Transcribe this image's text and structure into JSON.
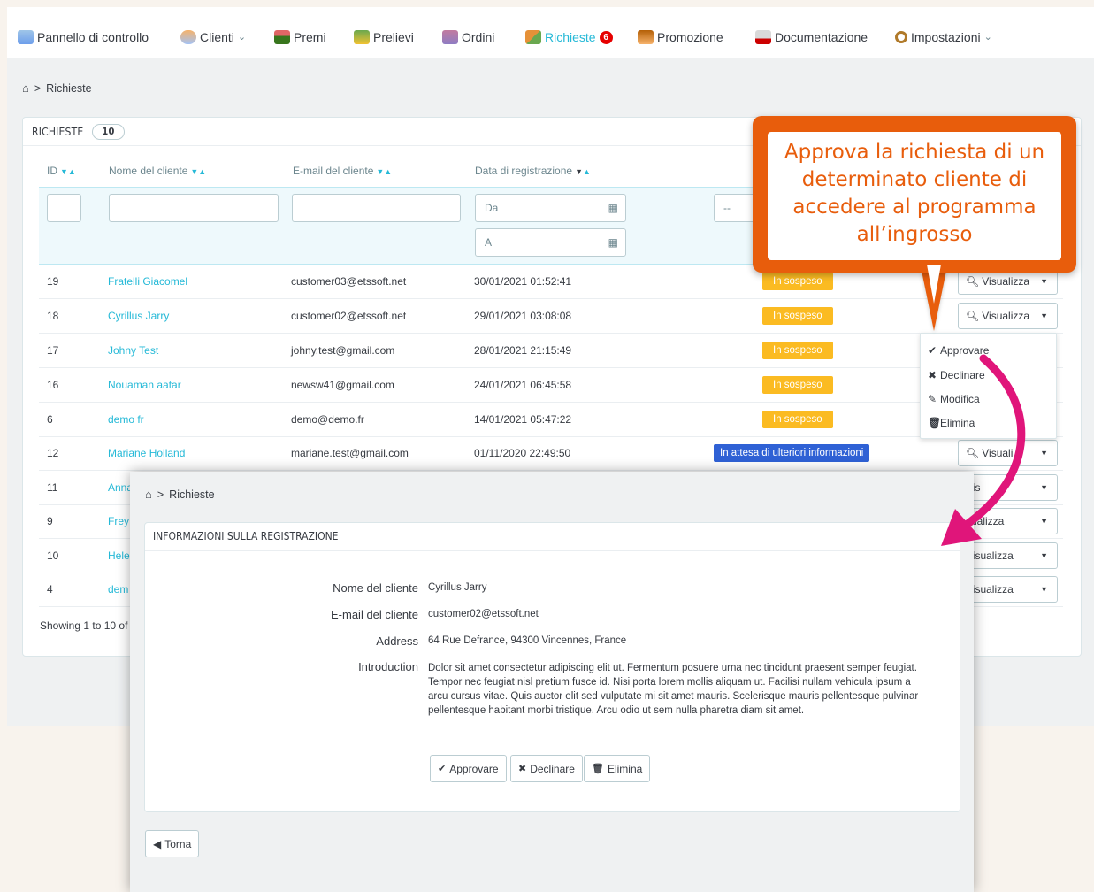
{
  "nav": {
    "items": [
      {
        "label": "Pannello di controllo",
        "icon": "dashboard-icon"
      },
      {
        "label": "Clienti",
        "icon": "customers-icon",
        "has_dropdown": true
      },
      {
        "label": "Premi",
        "icon": "rewards-icon"
      },
      {
        "label": "Prelievi",
        "icon": "withdrawals-icon"
      },
      {
        "label": "Ordini",
        "icon": "orders-icon"
      },
      {
        "label": "Richieste",
        "icon": "requests-icon",
        "badge": "6",
        "active": true
      },
      {
        "label": "Promozione",
        "icon": "promotion-icon"
      },
      {
        "label": "Documentazione",
        "icon": "documentation-icon"
      },
      {
        "label": "Impostazioni",
        "icon": "settings-icon",
        "has_dropdown": true
      }
    ]
  },
  "breadcrumb": {
    "current": "Richieste"
  },
  "list": {
    "title": "RICHIESTE",
    "count": "10",
    "columns": [
      "ID",
      "Nome del cliente",
      "E-mail del cliente",
      "Data di registrazione"
    ],
    "filters": {
      "date_from": "Da",
      "date_to": "A",
      "status_select": "--"
    },
    "rows": [
      {
        "id": "19",
        "name": "Fratelli Giacomel",
        "email": "customer03@etssoft.net",
        "date": "30/01/2021 01:52:41",
        "status": "In sospeso",
        "action": "Visualizza"
      },
      {
        "id": "18",
        "name": "Cyrillus Jarry",
        "email": "customer02@etssoft.net",
        "date": "29/01/2021 03:08:08",
        "status": "In sospeso",
        "action": "Visualizza"
      },
      {
        "id": "17",
        "name": "Johny Test",
        "email": "johny.test@gmail.com",
        "date": "28/01/2021 21:15:49",
        "status": "In sospeso"
      },
      {
        "id": "16",
        "name": "Nouaman aatar",
        "email": "newsw41@gmail.com",
        "date": "24/01/2021 06:45:58",
        "status": "In sospeso"
      },
      {
        "id": "6",
        "name": "demo fr",
        "email": "demo@demo.fr",
        "date": "14/01/2021 05:47:22",
        "status": "In sospeso"
      },
      {
        "id": "12",
        "name": "Mariane Holland",
        "email": "mariane.test@gmail.com",
        "date": "01/11/2020 22:49:50",
        "status": "In attesa di ulteriori informazioni",
        "action": "Visuali"
      },
      {
        "id": "11",
        "name": "Anna",
        "action": "Vis"
      },
      {
        "id": "9",
        "name": "Frey",
        "action": "sualizza"
      },
      {
        "id": "10",
        "name": "Hele",
        "action": "Visualizza"
      },
      {
        "id": "4",
        "name": "dem",
        "action": "Visualizza"
      }
    ],
    "showing": "Showing 1 to 10 of"
  },
  "dropdown": {
    "items": [
      {
        "label": "Approvare",
        "icon": "check-icon"
      },
      {
        "label": "Declinare",
        "icon": "times-icon"
      },
      {
        "label": "Modifica",
        "icon": "pencil-icon"
      },
      {
        "label": "Elimina",
        "icon": "trash-icon"
      }
    ]
  },
  "callout": {
    "text": "Approva la richiesta di un determinato cliente di accedere al programma all’ingrosso"
  },
  "detail": {
    "breadcrumb": "Richieste",
    "title": "INFORMAZIONI SULLA REGISTRAZIONE",
    "fields": [
      {
        "label": "Nome del cliente",
        "value": "Cyrillus Jarry"
      },
      {
        "label": "E-mail del cliente",
        "value": "customer02@etssoft.net"
      },
      {
        "label": "Address",
        "value": "64 Rue Defrance, 94300 Vincennes, France"
      },
      {
        "label": "Introduction",
        "value": "Dolor sit amet consectetur adipiscing elit ut. Fermentum posuere urna nec tincidunt praesent semper feugiat. Tempor nec feugiat nisl pretium fusce id. Nisi porta lorem mollis aliquam ut. Facilisi nullam vehicula ipsum a arcu cursus vitae. Quis auctor elit sed vulputate mi sit amet mauris. Scelerisque mauris pellentesque pulvinar pellentesque habitant morbi tristique. Arcu odio ut sem nulla pharetra diam sit amet."
      }
    ],
    "buttons": {
      "approve": "Approvare",
      "decline": "Declinare",
      "delete": "Elimina"
    },
    "back": "Torna"
  },
  "colors": {
    "accent": "#25b9d7",
    "callout": "#e85d0c",
    "pending": "#fbbb22",
    "info": "#2f61d5",
    "arrow": "#e0157a",
    "badge": "#e60000"
  }
}
